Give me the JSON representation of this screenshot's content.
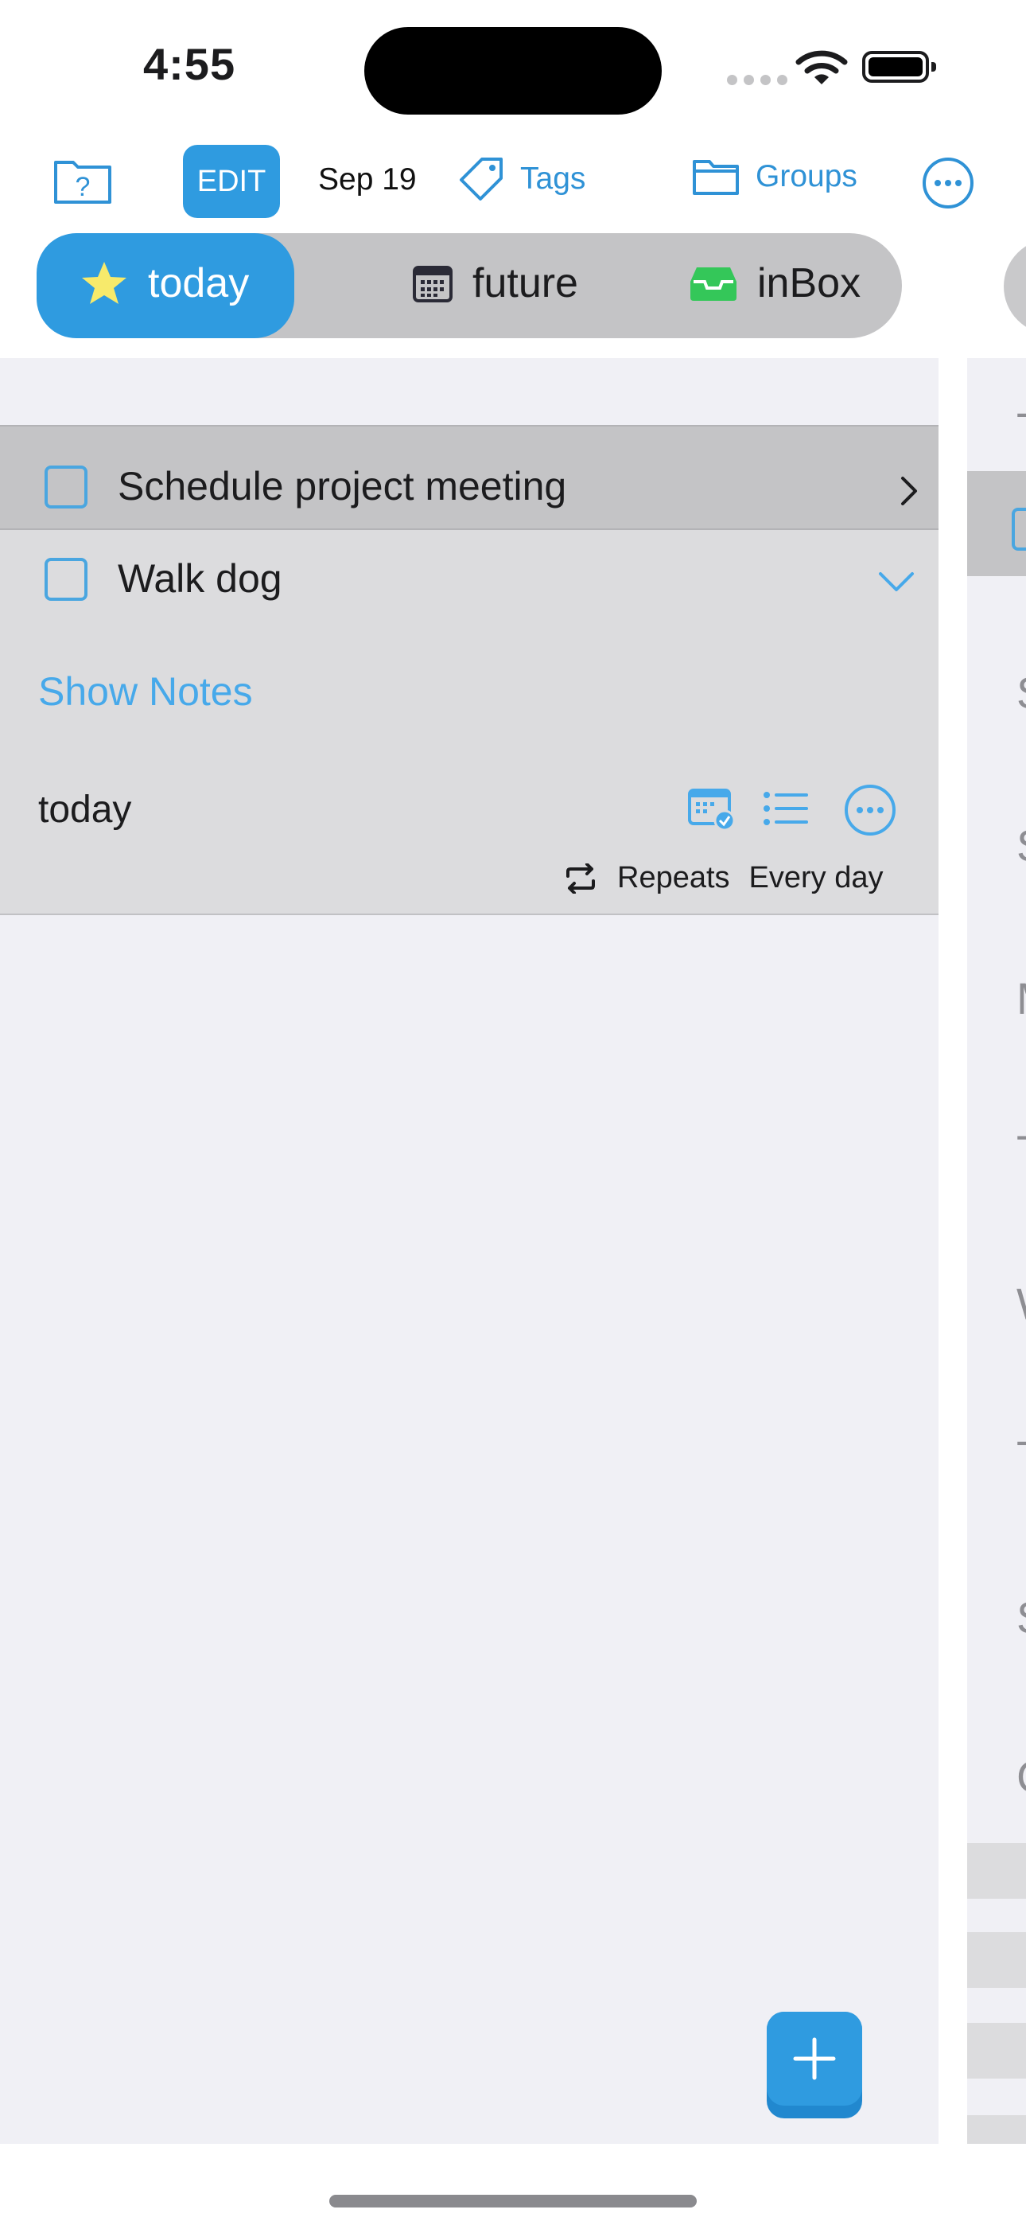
{
  "status_bar": {
    "time": "4:55"
  },
  "toolbar": {
    "edit_label": "EDIT",
    "date_label": "Sep 19",
    "tags_label": "Tags",
    "groups_label": "Groups",
    "help_icon": "folder-question-icon",
    "more_icon": "ellipsis-circle-icon"
  },
  "segments": [
    {
      "label": "today",
      "icon": "star-icon",
      "selected": true
    },
    {
      "label": "future",
      "icon": "calendar-icon",
      "selected": false
    },
    {
      "label": "inBox",
      "icon": "inbox-tray-icon",
      "selected": false
    }
  ],
  "tasks": [
    {
      "title": "Schedule project meeting",
      "checked": false,
      "expanded": false
    },
    {
      "title": "Walk dog",
      "checked": false,
      "expanded": true,
      "show_notes_label": "Show Notes",
      "when": "today",
      "repeats_label": "Repeats",
      "repeat_value": "Every day"
    }
  ],
  "side_panel_letters": [
    "T",
    "S",
    "S",
    "M",
    "T",
    "W",
    "T",
    "S",
    "C"
  ],
  "colors": {
    "accent": "#2f9be0",
    "link": "#47a9ea",
    "segment_bg": "#c4c4c6",
    "panel_bg": "#f0f0f5",
    "star": "#f7ea6b",
    "inbox": "#34c759"
  }
}
